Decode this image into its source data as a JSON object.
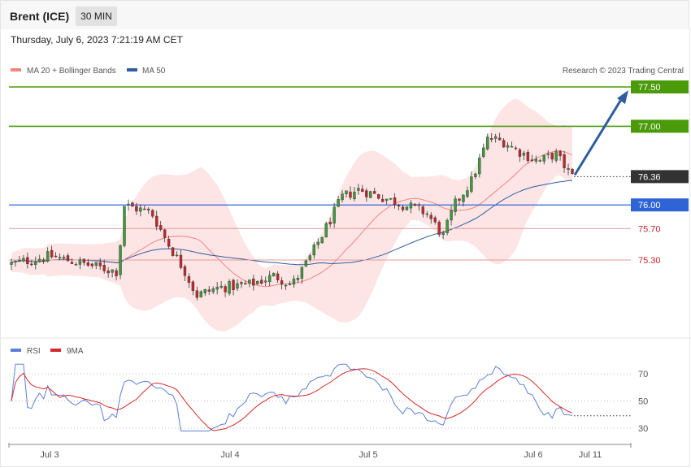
{
  "header": {
    "instrument": "Brent (ICE)",
    "timeframe": "30 MIN"
  },
  "timestamp": "Thursday, July 6, 2023 7:21:19 AM CET",
  "legend": [
    {
      "label": "MA 20 + Bollinger Bands",
      "color": "#f28482"
    },
    {
      "label": "MA 50",
      "color": "#2e5da0"
    }
  ],
  "copyright": "Research © 2023 Trading Central",
  "rsi_legend": [
    {
      "label": "RSI",
      "color": "#5b7fd6"
    },
    {
      "label": "9MA",
      "color": "#d62828"
    }
  ],
  "colors": {
    "up": "#3c9a3c",
    "down": "#c0282d",
    "resistance": "#4a9a0a",
    "support": "#2f64d6",
    "current": "#333333",
    "arrow": "#2e5da0",
    "bollinger": "#fde0e0"
  },
  "chart_data": {
    "type": "candlestick",
    "ylim": [
      74.7,
      77.85
    ],
    "x_ticks": [
      "Jul 3",
      "Jul 4",
      "Jul 5",
      "Jul 6",
      "Jul 11"
    ],
    "levels": [
      {
        "value": 77.5,
        "label": "77.50",
        "kind": "resistance"
      },
      {
        "value": 77.0,
        "label": "77.00",
        "kind": "resistance"
      },
      {
        "value": 76.36,
        "label": "76.36",
        "kind": "current"
      },
      {
        "value": 76.0,
        "label": "76.00",
        "kind": "support"
      },
      {
        "value": 75.7,
        "label": "75.70",
        "kind": "minor"
      },
      {
        "value": 75.3,
        "label": "75.30",
        "kind": "minor"
      }
    ],
    "current_price": 76.36,
    "target": 77.5,
    "series": [
      {
        "name": "MA 20 + Bollinger Bands"
      },
      {
        "name": "MA 50"
      }
    ],
    "rsi": {
      "ylim": [
        20,
        80
      ],
      "ticks": [
        70,
        50,
        30
      ]
    }
  }
}
